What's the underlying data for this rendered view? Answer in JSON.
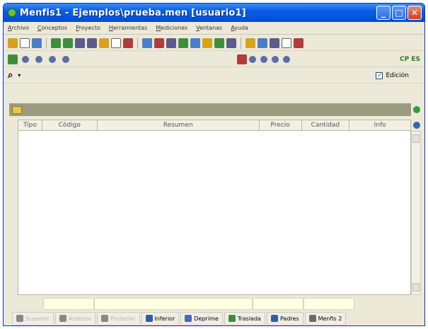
{
  "window": {
    "title": "Menfis1 - Ejemplos\\prueba.men  [usuario1]",
    "controls": [
      "minimize-icon",
      "maximize-icon",
      "close-icon"
    ]
  },
  "menu": {
    "items": [
      "Archivo",
      "Conceptos",
      "Proyecto",
      "Herramientas",
      "Mediciones",
      "Ventanas",
      "Ayuda"
    ]
  },
  "toolbar2": {
    "cp_label": "CP ES"
  },
  "toolbar3": {
    "binoculars": "Ω",
    "edicion_label": "Edición",
    "edicion_checked": true
  },
  "table": {
    "columns": [
      "Tipo",
      "Código",
      "Resumen",
      "Precio",
      "Cantidad",
      "Info"
    ]
  },
  "bottom_buttons": [
    {
      "label": "Superior",
      "enabled": false
    },
    {
      "label": "Anterior",
      "enabled": false
    },
    {
      "label": "Posterior",
      "enabled": false
    },
    {
      "label": "Inferior",
      "enabled": true
    },
    {
      "label": "Deprime",
      "enabled": true
    },
    {
      "label": "Traslada",
      "enabled": true
    },
    {
      "label": "Padres",
      "enabled": true
    },
    {
      "label": "Menfis 2",
      "enabled": true
    }
  ]
}
